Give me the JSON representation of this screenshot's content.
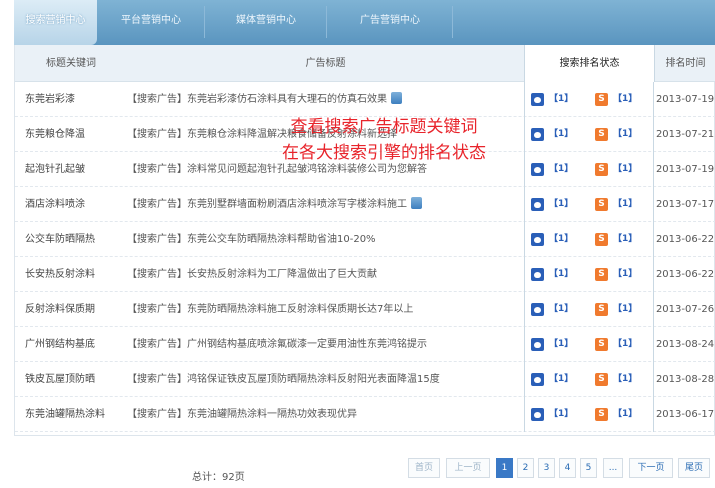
{
  "tabs": [
    {
      "label": "搜索营销中心",
      "active": true
    },
    {
      "label": "平台营销中心",
      "active": false
    },
    {
      "label": "媒体营销中心",
      "active": false
    },
    {
      "label": "广告营销中心",
      "active": false
    }
  ],
  "table": {
    "headers": {
      "keyword": "标题关键词",
      "title": "广告标题",
      "status": "搜索排名状态",
      "date": "排名时间"
    },
    "rows": [
      {
        "keyword": "东莞岩彩漆",
        "title": "【搜索广告】东莞岩彩漆仿石涂料具有大理石的仿真石效果",
        "rank_baidu": "【1】",
        "rank_sogou": "【1】",
        "date": "2013-07-19",
        "has_icon": true
      },
      {
        "keyword": "东莞粮仓降温",
        "title": "【搜索广告】东莞粮仓涂料降温解决粮食储备反射涂料新选择",
        "rank_baidu": "【1】",
        "rank_sogou": "【1】",
        "date": "2013-07-21",
        "has_icon": false
      },
      {
        "keyword": "起泡针孔起皱",
        "title": "【搜索广告】涂料常见问题起泡针孔起皱鸿铭涂料装修公司为您解答",
        "rank_baidu": "【1】",
        "rank_sogou": "【1】",
        "date": "2013-07-19",
        "has_icon": false
      },
      {
        "keyword": "酒店涂料喷涂",
        "title": "【搜索广告】东莞别墅群墙面粉刷酒店涂料喷涂写字楼涂料施工",
        "rank_baidu": "【1】",
        "rank_sogou": "【1】",
        "date": "2013-07-17",
        "has_icon": true
      },
      {
        "keyword": "公交车防晒隔热",
        "title": "【搜索广告】东莞公交车防晒隔热涂料帮助省油10-20%",
        "rank_baidu": "【1】",
        "rank_sogou": "【1】",
        "date": "2013-06-22",
        "has_icon": false
      },
      {
        "keyword": "长安热反射涂料",
        "title": "【搜索广告】长安热反射涂料为工厂降温做出了巨大贡献",
        "rank_baidu": "【1】",
        "rank_sogou": "【1】",
        "date": "2013-06-22",
        "has_icon": false
      },
      {
        "keyword": "反射涂料保质期",
        "title": "【搜索广告】东莞防晒隔热涂料施工反射涂料保质期长达7年以上",
        "rank_baidu": "【1】",
        "rank_sogou": "【1】",
        "date": "2013-07-26",
        "has_icon": false
      },
      {
        "keyword": "广州钢结构基底",
        "title": "【搜索广告】广州钢结构基底喷涂氟碳漆一定要用油性东莞鸿铭提示",
        "rank_baidu": "【1】",
        "rank_sogou": "【1】",
        "date": "2013-08-24",
        "has_icon": false
      },
      {
        "keyword": "铁皮瓦屋顶防晒",
        "title": "【搜索广告】鸿铭保证铁皮瓦屋顶防晒隔热涂料反射阳光表面降温15度",
        "rank_baidu": "【1】",
        "rank_sogou": "【1】",
        "date": "2013-08-28",
        "has_icon": false
      },
      {
        "keyword": "东莞油罐隔热涂料",
        "title": "【搜索广告】东莞油罐隔热涂料一隔热功效表现优异",
        "rank_baidu": "【1】",
        "rank_sogou": "【1】",
        "date": "2013-06-17",
        "has_icon": false
      }
    ]
  },
  "overlay": {
    "line1": "查看搜索广告标题关键词",
    "line2": "在各大搜索引擎的排名状态"
  },
  "footer": {
    "total": "总计：92页",
    "first": "首页",
    "prev": "上一页",
    "pages": [
      "1",
      "2",
      "3",
      "4",
      "5"
    ],
    "current_page": "1",
    "ellipsis": "...",
    "next": "下一页",
    "last": "尾页"
  },
  "colors": {
    "tab_bar": "#6aa3ca",
    "header_bg": "#eaf1f7",
    "overlay_text": "#e8242b",
    "rank_text": "#2a5fb8",
    "current_page": "#3a79c6"
  },
  "icons": {
    "engine1": "baidu-paw-icon",
    "engine2": "sogou-s-icon",
    "title_doc": "document-icon"
  }
}
